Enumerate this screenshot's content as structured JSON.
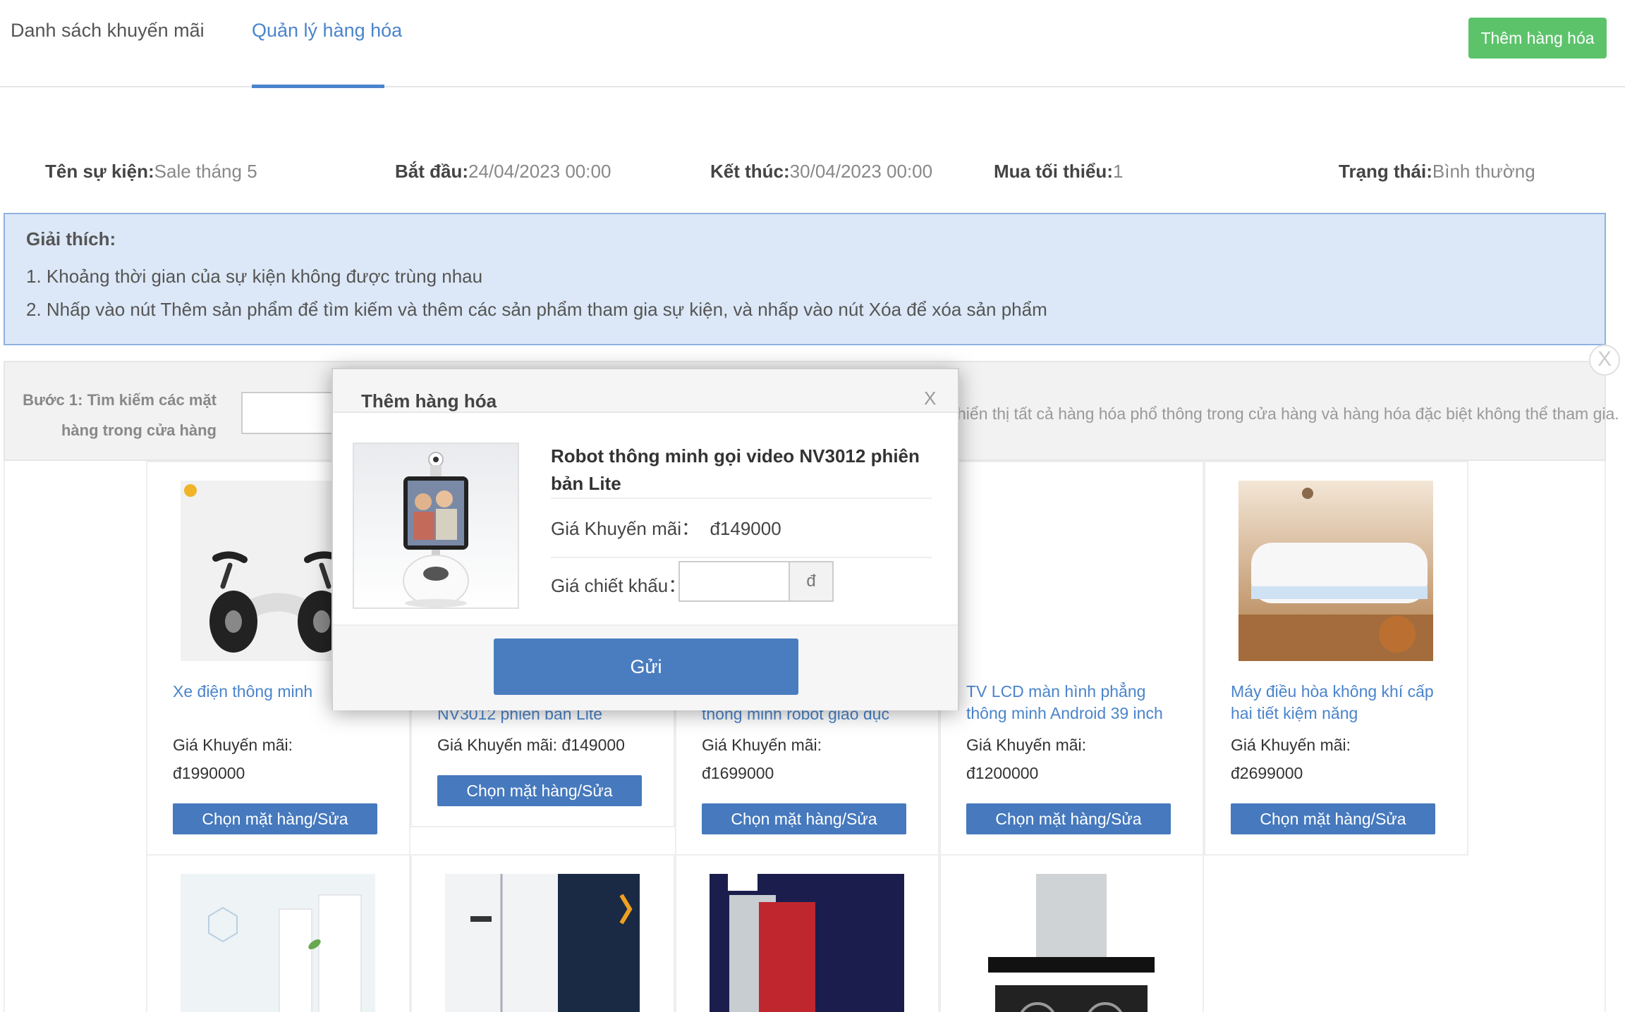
{
  "tabs": [
    {
      "label": "Danh sách khuyến mãi",
      "active": false
    },
    {
      "label": "Quản lý hàng hóa",
      "active": true
    }
  ],
  "add_goods_button": "Thêm hàng hóa",
  "event_info": {
    "name_label": "Tên sự kiện:",
    "name_value": "Sale tháng 5",
    "start_label": "Bắt đầu:",
    "start_value": "24/04/2023 00:00",
    "end_label": "Kết thúc:",
    "end_value": "30/04/2023 00:00",
    "min_label": "Mua tối thiểu:",
    "min_value": "1",
    "status_label": "Trạng thái:",
    "status_value": "Bình thường"
  },
  "explanation": {
    "title": "Giải thích:",
    "lines": [
      "1. Khoảng thời gian của sự kiện không được trùng nhau",
      "2. Nhấp vào nút Thêm sản phẩm để tìm kiếm và thêm các sản phẩm tham gia sự kiện, và nhấp vào nút Xóa để xóa sản phẩm"
    ]
  },
  "search": {
    "step_line1": "Bước 1: Tìm kiếm các mặt",
    "step_line2": "hàng trong cửa hàng",
    "hint": "hiển thị tất cả hàng hóa phổ thông trong cửa hàng và hàng hóa đặc biệt không thể tham gia.",
    "close_symbol": "X"
  },
  "products": [
    {
      "name": "Xe điện thông minh",
      "price_label": "Giá Khuyến mãi:",
      "price": "đ1990000",
      "button": "Chọn mặt hàng/Sửa",
      "icon": "scooter-icon"
    },
    {
      "name": "NV3012 phiên bản Lite",
      "price_label": "Giá Khuyến mãi:",
      "price": "đ149000",
      "button": "Chọn mặt hàng/Sửa",
      "icon": "robot-icon"
    },
    {
      "name": "thông minh robot giáo dục",
      "price_label": "Giá Khuyến mãi:",
      "price": "đ1699000",
      "button": "Chọn mặt hàng/Sửa",
      "icon": "robot-icon"
    },
    {
      "name": "TV LCD màn hình phẳng thông minh Android 39 inch",
      "price_label": "Giá Khuyến mãi:",
      "price": "đ1200000",
      "button": "Chọn mặt hàng/Sửa",
      "icon": "tv-icon"
    },
    {
      "name": "Máy điều hòa không khí cấp hai tiết kiệm năng",
      "price_label": "Giá Khuyến mãi:",
      "price": "đ2699000",
      "button": "Chọn mặt hàng/Sửa",
      "icon": "air-conditioner-icon"
    }
  ],
  "modal": {
    "title": "Thêm hàng hóa",
    "close_symbol": "X",
    "product_name": "Robot thông minh gọi video NV3012 phiên bản Lite",
    "price_label": "Giá Khuyến mãi：",
    "price_value": "đ149000",
    "discount_label": "Giá chiết khấu：",
    "discount_value": "",
    "currency": "đ",
    "submit": "Gửi"
  },
  "colors": {
    "accent": "#4a84cb",
    "button_blue": "#4679bd",
    "green": "#5cc36b",
    "info_bg": "#dce8f7"
  }
}
